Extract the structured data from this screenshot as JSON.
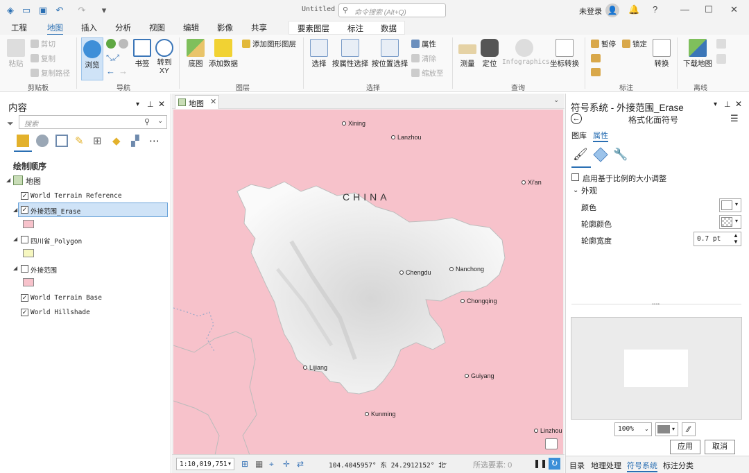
{
  "app": {
    "title": "Untitled",
    "user": "未登录",
    "command_search_placeholder": "命令搜索 (Alt+Q)"
  },
  "tabs": [
    "工程",
    "地图",
    "插入",
    "分析",
    "视图",
    "编辑",
    "影像",
    "共享"
  ],
  "active_tab": "地图",
  "context_tabs": [
    "要素图层",
    "标注",
    "数据"
  ],
  "ribbon": {
    "clipboard": {
      "paste": "粘贴",
      "cut": "剪切",
      "copy": "复制",
      "copy_path": "复制路径",
      "group": "剪贴板"
    },
    "navigate": {
      "explore": "浏览",
      "bookmarks": "书签",
      "goto": "转到\nXY",
      "group": "导航"
    },
    "layer": {
      "basemap": "底图",
      "add_data": "添加数据",
      "add_graphics": "添加图形图层",
      "group": "图层"
    },
    "selection": {
      "select": "选择",
      "by_attr": "按属性选择",
      "by_loc": "按位置选择",
      "attributes": "属性",
      "clear": "清除",
      "zoom_to": "缩放至",
      "group": "选择"
    },
    "inquiry": {
      "measure": "测量",
      "locate": "定位",
      "infographics": "Infographics",
      "coord_convert": "坐标转换",
      "group": "查询"
    },
    "labeling": {
      "pause": "暂停",
      "lock": "锁定",
      "convert": "转换",
      "group": "标注"
    },
    "offline": {
      "download_map": "下载地图",
      "group": "离线"
    }
  },
  "contents": {
    "title": "内容",
    "search_placeholder": "搜索",
    "drawing_order": "绘制顺序",
    "map_name": "地图",
    "layers": [
      {
        "name": "World Terrain Reference",
        "checked": true,
        "swatch": null
      },
      {
        "name": "外接范围_Erase",
        "checked": true,
        "swatch": "#f7c2cb",
        "selected": true
      },
      {
        "name": "四川省_Polygon",
        "checked": false,
        "swatch": "#f6f7c0"
      },
      {
        "name": "外接范围",
        "checked": false,
        "swatch": "#f7c2cb"
      },
      {
        "name": "World Terrain Base",
        "checked": true,
        "swatch": null
      },
      {
        "name": "World Hillshade",
        "checked": true,
        "swatch": null
      }
    ]
  },
  "map": {
    "tab": "地图",
    "country_label": "CHINA",
    "cities": [
      "Xining",
      "Lanzhou",
      "Xi'an",
      "Chengdu",
      "Nanchong",
      "Chongqing",
      "Lijiang",
      "Guiyang",
      "Kunming",
      "Linzhou"
    ],
    "scale": "1:10,019,751",
    "coordinates": "104.4045957° 东 24.2912152° 北",
    "selected_features": "所选要素: 0",
    "fill_color": "#f7c2cb"
  },
  "symbology": {
    "title": "符号系统 - 外接范围_Erase",
    "subtitle": "格式化面符号",
    "tabs": [
      "图库",
      "属性"
    ],
    "active_tab": "属性",
    "scale_checkbox": "启用基于比例的大小调整",
    "section": "外观",
    "color_label": "颜色",
    "outline_color_label": "轮廓颜色",
    "outline_width_label": "轮廓宽度",
    "outline_width_value": "0.7 pt",
    "zoom": "100%",
    "apply": "应用",
    "cancel": "取消"
  },
  "bottom_tabs": [
    "目录",
    "地理处理",
    "符号系统",
    "标注分类"
  ],
  "active_bottom_tab": "符号系统"
}
